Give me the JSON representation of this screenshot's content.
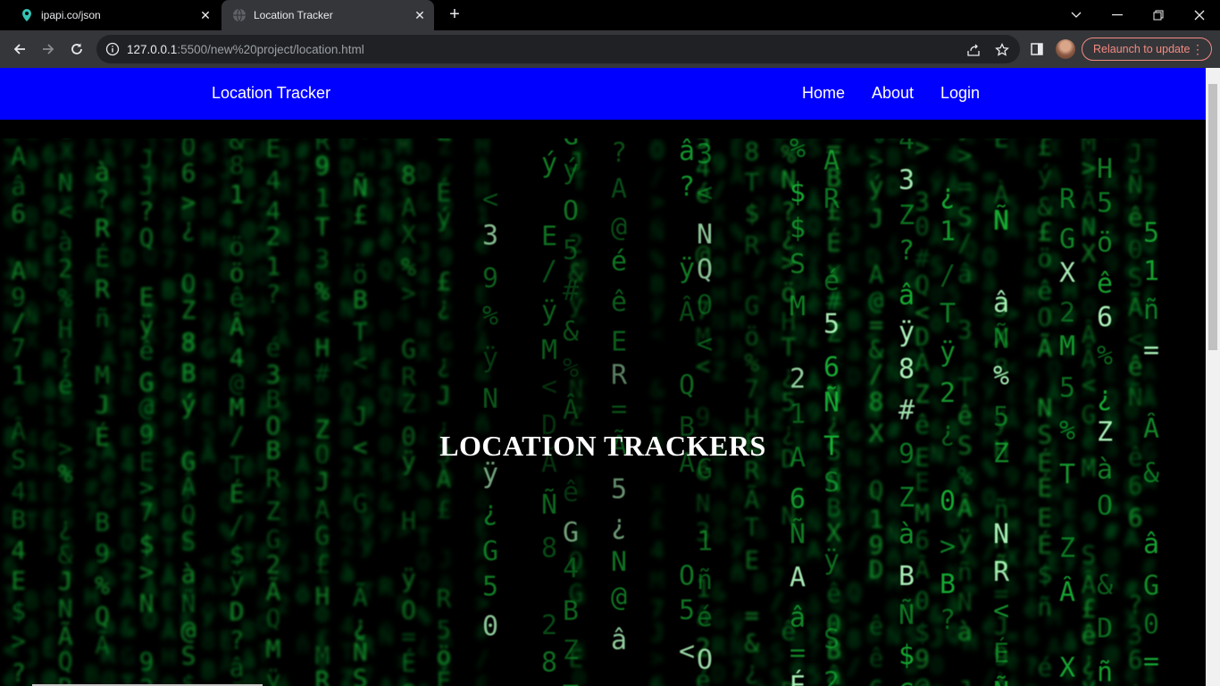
{
  "browser": {
    "tabs": [
      {
        "title": "ipapi.co/json",
        "icon": "map-pin-icon"
      },
      {
        "title": "Location Tracker",
        "icon": "globe-icon"
      }
    ],
    "url_host": "127.0.0.1",
    "url_rest": ":5500/new%20project/location.html",
    "relaunch_label": "Relaunch to update"
  },
  "navbar": {
    "brand": "Location Tracker",
    "links": [
      "Home",
      "About",
      "Login"
    ]
  },
  "hero": {
    "title": "LOCATION TRACKERS"
  },
  "colors": {
    "navbar_bg": "#0000ff",
    "matrix_green": "#19c23a"
  }
}
